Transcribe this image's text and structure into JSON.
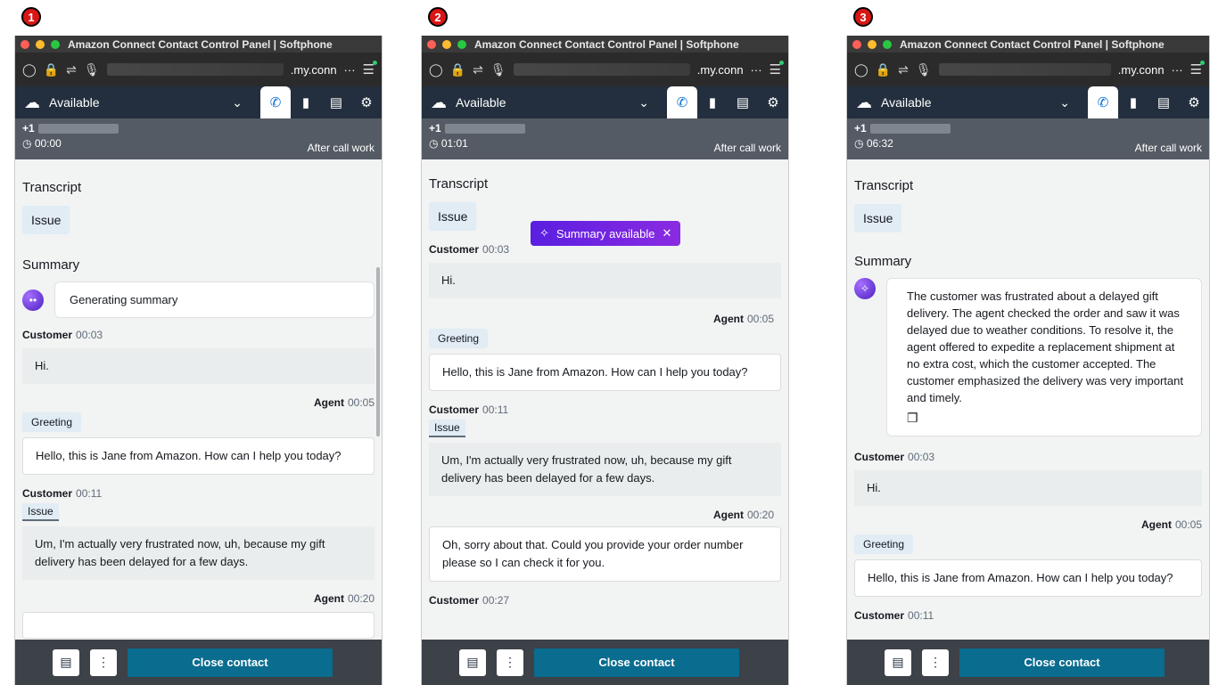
{
  "common": {
    "window_title": "Amazon Connect Contact Control Panel | Softphone",
    "status": "Available",
    "phone_prefix": "+1",
    "after_call_work": "After call work",
    "transcript_title": "Transcript",
    "issue_chip": "Issue",
    "summary_title": "Summary",
    "close_contact": "Close contact",
    "more_icon": "⋮",
    "url_more": "···"
  },
  "panels": [
    {
      "step": "1",
      "url_text": ".my.conn",
      "timer": "00:00",
      "generating": "Generating summary",
      "messages": [
        {
          "speaker": "Customer",
          "time": "00:03",
          "text": "Hi."
        },
        {
          "speaker": "Agent",
          "time": "00:05",
          "tag": "Greeting",
          "text": "Hello, this is Jane from Amazon. How can I help you today?"
        },
        {
          "speaker": "Customer",
          "time": "00:11",
          "tag": "Issue",
          "text": "Um, I'm actually very frustrated now, uh, because my gift delivery has been delayed for a few days."
        },
        {
          "speaker": "Agent",
          "time": "00:20"
        }
      ]
    },
    {
      "step": "2",
      "url_text": ".my.conn",
      "timer": "01:01",
      "toast": "Summary available",
      "messages": [
        {
          "speaker": "Customer",
          "time": "00:03",
          "text": "Hi."
        },
        {
          "speaker": "Agent",
          "time": "00:05",
          "tag": "Greeting",
          "text": "Hello, this is Jane from Amazon. How can I help you today?"
        },
        {
          "speaker": "Customer",
          "time": "00:11",
          "tag": "Issue",
          "text": "Um, I'm actually very frustrated now, uh, because my gift delivery has been delayed for a few days."
        },
        {
          "speaker": "Agent",
          "time": "00:20",
          "text": "Oh, sorry about that. Could you provide your order number please so I can check it for you."
        },
        {
          "speaker": "Customer",
          "time": "00:27"
        }
      ]
    },
    {
      "step": "3",
      "url_text": ".my.conn",
      "timer": "06:32",
      "summary_text": "The customer was frustrated about a delayed gift delivery. The agent checked the order and saw it was delayed due to weather conditions. To resolve it, the agent offered to expedite a replacement shipment at no extra cost, which the customer accepted. The customer emphasized the delivery was very important and timely.",
      "messages": [
        {
          "speaker": "Customer",
          "time": "00:03",
          "text": "Hi."
        },
        {
          "speaker": "Agent",
          "time": "00:05",
          "tag": "Greeting",
          "text": "Hello, this is Jane from Amazon. How can I help you today?"
        },
        {
          "speaker": "Customer",
          "time": "00:11"
        }
      ]
    }
  ]
}
